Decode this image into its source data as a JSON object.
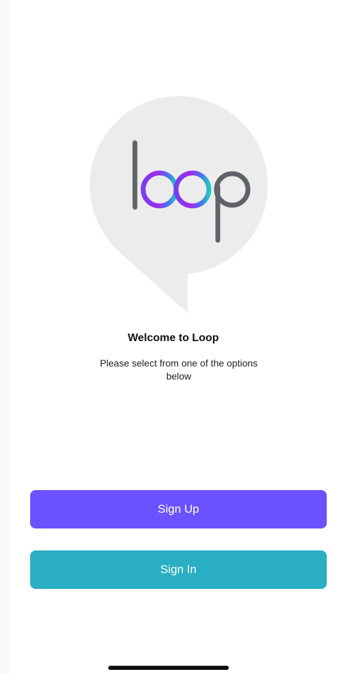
{
  "app": {
    "logo_text": "loop"
  },
  "welcome": {
    "title": "Welcome to Loop",
    "subtitle": "Please select from one of the options below"
  },
  "actions": {
    "sign_up_label": "Sign Up",
    "sign_in_label": "Sign In"
  },
  "colors": {
    "sign_up_button": "#6a52ff",
    "sign_in_button": "#2aaec4",
    "bubble": "#ececec",
    "logo_letters": "#5f6368"
  },
  "icons": {
    "logo": "loop-speech-bubble-logo",
    "home_indicator": "home-indicator-bar"
  }
}
